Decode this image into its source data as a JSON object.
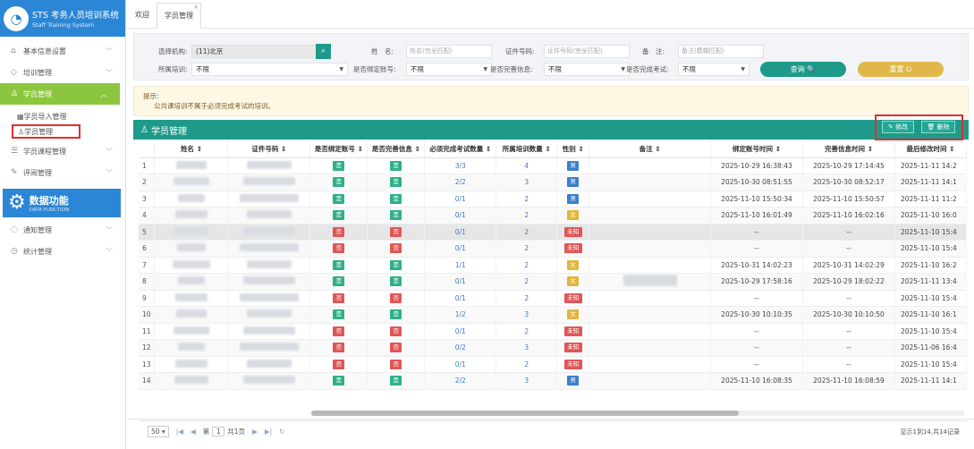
{
  "app": {
    "title": "STS 考务人员培训系统",
    "subtitle": "Staff Training System"
  },
  "sidebar": {
    "items": [
      {
        "label": "基本信息设置",
        "icon": "home-icon"
      },
      {
        "label": "培训管理",
        "icon": "graduation-icon"
      },
      {
        "label": "学员管理",
        "icon": "user-icon"
      },
      {
        "label": "学员课程管理",
        "icon": "list-icon"
      },
      {
        "label": "评阅管理",
        "icon": "edit-icon"
      },
      {
        "label": "通知管理",
        "icon": "chat-icon"
      },
      {
        "label": "统计管理",
        "icon": "clock-icon"
      }
    ],
    "subitems": [
      "学员导入管理",
      "学员管理"
    ],
    "banner": {
      "title": "数据功能",
      "subtitle": "DATA FUNCTION"
    }
  },
  "tabs": [
    "欢迎",
    "学员管理"
  ],
  "filters": {
    "org_label": "选择机构:",
    "org_value": "(11)北京",
    "name_label": "姓　名:",
    "name_placeholder": "姓名(完全匹配)",
    "id_label": "证件号码:",
    "id_placeholder": "证件号码(完全匹配)",
    "note_label": "备　注:",
    "note_placeholder": "备注(模糊匹配)",
    "training_label": "所属培训:",
    "training_value": "不限",
    "bind_label": "是否绑定账号:",
    "bind_value": "不限",
    "info_label": "是否完善信息:",
    "info_value": "不限",
    "exam_label": "是否完成考试:",
    "exam_value": "不限",
    "query_btn": "查询 🔍",
    "reset_btn": "重置 ⭘"
  },
  "tip": {
    "title": "提示:",
    "text": "公共课培训不属于必须完成考试的培训。"
  },
  "grid": {
    "title": "学员管理",
    "edit_btn": "✎ 修改",
    "delete_btn": "🗑 删除",
    "columns": [
      "姓名 ⇕",
      "证件号码 ⇕",
      "是否绑定账号 ⇕",
      "是否完善信息 ⇕",
      "必须完成考试数量 ⇕",
      "所属培训数量 ⇕",
      "性别 ⇕",
      "备注 ⇕",
      "绑定账号时间 ⇕",
      "完善信息时间 ⇕",
      "最后修改时间 ⇕"
    ],
    "rows": [
      {
        "no": "1",
        "bind": "是",
        "info": "是",
        "exam": "3/3",
        "train": "4",
        "sex": "男",
        "bind_time": "2025-10-29 16:38:43",
        "info_time": "2025-10-29 17:14:45",
        "mod_time": "2025-11-11 14:2"
      },
      {
        "no": "2",
        "bind": "是",
        "info": "是",
        "exam": "2/2",
        "train": "3",
        "sex": "男",
        "bind_time": "2025-10-30 08:51:55",
        "info_time": "2025-10-30 08:52:17",
        "mod_time": "2025-11-11 14:1"
      },
      {
        "no": "3",
        "bind": "是",
        "info": "是",
        "exam": "0/1",
        "train": "2",
        "sex": "男",
        "bind_time": "2025-11-10 15:50:34",
        "info_time": "2025-11-10 15:50:57",
        "mod_time": "2025-11-11 11:2"
      },
      {
        "no": "4",
        "bind": "是",
        "info": "是",
        "exam": "0/1",
        "train": "2",
        "sex": "女",
        "bind_time": "2025-11-10 16:01:49",
        "info_time": "2025-11-10 16:02:16",
        "mod_time": "2025-11-10 16:0"
      },
      {
        "no": "5",
        "bind": "否",
        "info": "否",
        "exam": "0/1",
        "train": "2",
        "sex": "未知",
        "bind_time": "--",
        "info_time": "--",
        "mod_time": "2025-11-10 15:4"
      },
      {
        "no": "6",
        "bind": "否",
        "info": "否",
        "exam": "0/1",
        "train": "2",
        "sex": "未知",
        "bind_time": "--",
        "info_time": "--",
        "mod_time": "2025-11-10 15:4"
      },
      {
        "no": "7",
        "bind": "是",
        "info": "是",
        "exam": "1/1",
        "train": "2",
        "sex": "女",
        "bind_time": "2025-10-31 14:02:23",
        "info_time": "2025-10-31 14:02:29",
        "mod_time": "2025-11-10 16:2"
      },
      {
        "no": "8",
        "bind": "是",
        "info": "是",
        "exam": "0/1",
        "train": "2",
        "sex": "女",
        "bind_time": "2025-10-29 17:58:16",
        "info_time": "2025-10-29 18:02:22",
        "mod_time": "2025-11-11 13:4"
      },
      {
        "no": "9",
        "bind": "否",
        "info": "否",
        "exam": "0/1",
        "train": "2",
        "sex": "未知",
        "bind_time": "--",
        "info_time": "--",
        "mod_time": "2025-11-10 15:4"
      },
      {
        "no": "10",
        "bind": "是",
        "info": "是",
        "exam": "1/2",
        "train": "3",
        "sex": "女",
        "bind_time": "2025-10-30 10:10:35",
        "info_time": "2025-10-30 10:10:50",
        "mod_time": "2025-11-10 16:1"
      },
      {
        "no": "11",
        "bind": "否",
        "info": "否",
        "exam": "0/1",
        "train": "2",
        "sex": "未知",
        "bind_time": "--",
        "info_time": "--",
        "mod_time": "2025-11-10 15:4"
      },
      {
        "no": "12",
        "bind": "否",
        "info": "否",
        "exam": "0/2",
        "train": "3",
        "sex": "未知",
        "bind_time": "--",
        "info_time": "--",
        "mod_time": "2025-11-06 16:4"
      },
      {
        "no": "13",
        "bind": "否",
        "info": "否",
        "exam": "0/1",
        "train": "2",
        "sex": "未知",
        "bind_time": "--",
        "info_time": "--",
        "mod_time": "2025-11-10 15:4"
      },
      {
        "no": "14",
        "bind": "是",
        "info": "是",
        "exam": "2/2",
        "train": "3",
        "sex": "男",
        "bind_time": "2025-11-10 16:08:35",
        "info_time": "2025-11-10 16:08:59",
        "mod_time": "2025-11-11 14:1"
      }
    ]
  },
  "pager": {
    "page_size": "50",
    "page_label": "第",
    "page_value": "1",
    "total_pages": "共1页",
    "info": "显示1到14,共14记录"
  },
  "colors": {
    "teal": "#1f9a8a",
    "green": "#8cc63e",
    "blue": "#2b86d6",
    "red": "#e02f2f",
    "yellow": "#e0b84a"
  }
}
